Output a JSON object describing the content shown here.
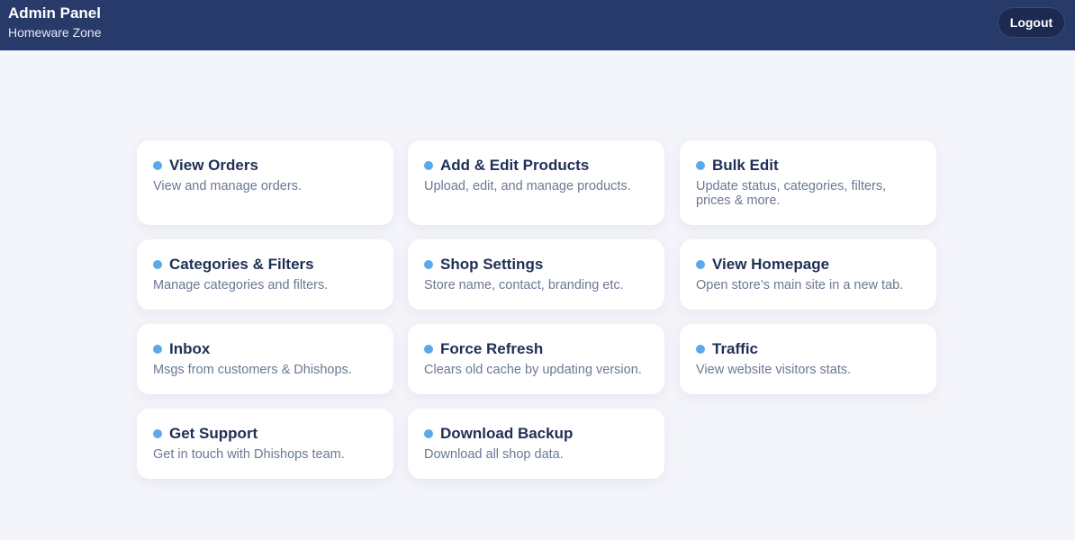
{
  "header": {
    "title": "Admin Panel",
    "subtitle": "Homeware Zone",
    "logout_label": "Logout"
  },
  "colors": {
    "header_bg": "#273a6a",
    "accent_dot": "#5aa9ec",
    "page_bg": "#f4f5fa"
  },
  "cards": [
    {
      "title": "View Orders",
      "desc": "View and manage orders."
    },
    {
      "title": "Add & Edit Products",
      "desc": "Upload, edit, and manage products."
    },
    {
      "title": "Bulk Edit",
      "desc": "Update status, categories, filters, prices & more."
    },
    {
      "title": "Categories & Filters",
      "desc": "Manage categories and filters."
    },
    {
      "title": "Shop Settings",
      "desc": "Store name, contact, branding etc."
    },
    {
      "title": "View Homepage",
      "desc": "Open store’s main site in a new tab."
    },
    {
      "title": "Inbox",
      "desc": "Msgs from customers & Dhishops."
    },
    {
      "title": "Force Refresh",
      "desc": "Clears old cache by updating version."
    },
    {
      "title": "Traffic",
      "desc": "View website visitors stats."
    },
    {
      "title": "Get Support",
      "desc": "Get in touch with Dhishops team."
    },
    {
      "title": "Download Backup",
      "desc": "Download all shop data."
    }
  ]
}
